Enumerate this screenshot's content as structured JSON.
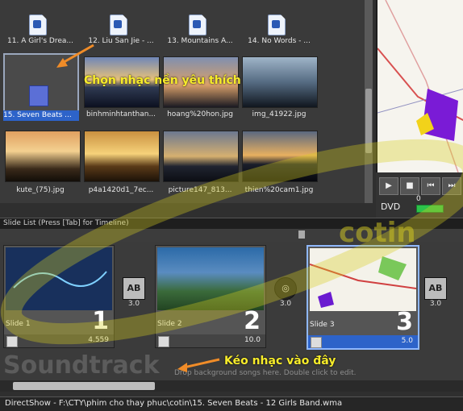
{
  "browser": {
    "audio_files": [
      {
        "label": "11. A Girl's Drea..."
      },
      {
        "label": "12. Liu San Jie - ..."
      },
      {
        "label": "13. Mountains A..."
      },
      {
        "label": "14. No Words - ..."
      }
    ],
    "selected_audio": "15. Seven Beats ...",
    "images_row1": [
      "binhminhtanthan...",
      "hoang%20hon.jpg",
      "img_41922.jpg"
    ],
    "images_row2": [
      "kute_(75).jpg",
      "p4a1420d1_7ec...",
      "picture147_813...",
      "thien%20cam1.jpg"
    ]
  },
  "annotations": {
    "choose_music": "Chọn nhạc nền yêu thích",
    "drag_music": "Kéo nhạc vào đây"
  },
  "preview": {
    "format_label": "DVD",
    "meter_value": "0",
    "controls": [
      "play",
      "stop",
      "previous",
      "next"
    ]
  },
  "timeline": {
    "header": "Slide List (Press [Tab] for Timeline)",
    "slides": [
      {
        "label": "Slide 1",
        "number": "1",
        "duration": "4.559"
      },
      {
        "label": "Slide 2",
        "number": "2",
        "duration": "10.0"
      },
      {
        "label": "Slide 3",
        "number": "3",
        "duration": "5.0"
      }
    ],
    "transitions": [
      {
        "duration": "3.0"
      },
      {
        "duration": "3.0"
      },
      {
        "duration": "3.0"
      }
    ]
  },
  "soundtrack": {
    "title": "Soundtrack",
    "hint": "Drop background songs here.  Double click to edit."
  },
  "status_bar": "DirectShow - F:\\CTY\\phim cho thay phuc\\cotin\\15. Seven Beats - 12 Girls Band.wma",
  "watermark": "cotin",
  "colors": {
    "selection": "#2d63c9",
    "annotation": "#f7ec2a",
    "arrow": "#f08c28"
  }
}
